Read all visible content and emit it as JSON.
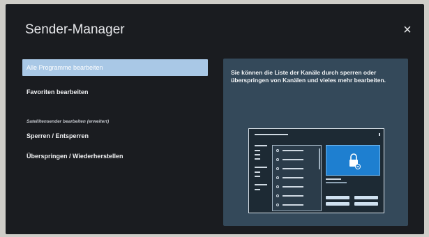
{
  "header": {
    "title": "Sender-Manager",
    "close_label": "×"
  },
  "menu": {
    "items": [
      {
        "label": "Alle Programme bearbeiten",
        "selected": true
      },
      {
        "label": "Favoriten bearbeiten",
        "selected": false
      },
      {
        "label": "Sperren / Entsperren",
        "selected": false
      },
      {
        "label": "Überspringen / Wiederherstellen",
        "selected": false
      }
    ],
    "section_label": "Satellitensender bearbeiten (erweitert)"
  },
  "preview": {
    "description": "Sie können die Liste der Kanäle durch sperren oder überspringen von Kanälen und vieles mehr bearbeiten."
  },
  "colors": {
    "background": "#1a1c20",
    "selected_item": "#a9c8e6",
    "panel": "#34495a",
    "illustration_screen": "#1e7fd0"
  },
  "icons": {
    "close": "close-icon",
    "illustration_lock": "lock-icon"
  }
}
